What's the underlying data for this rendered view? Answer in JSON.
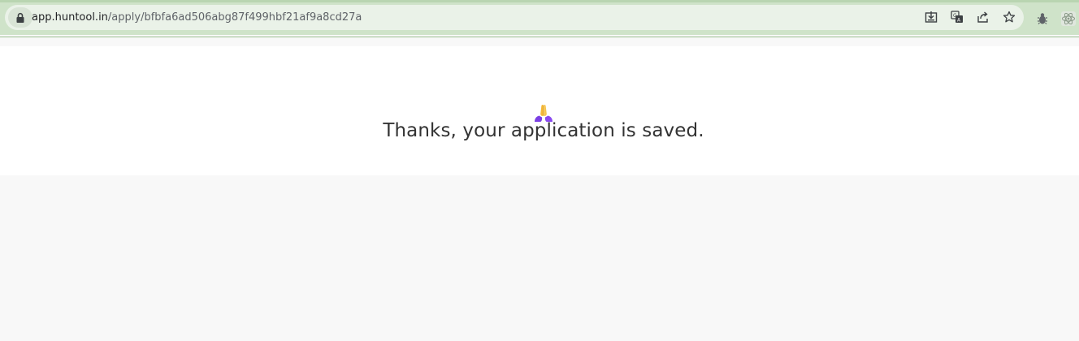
{
  "browser": {
    "url_domain": "app.huntool.in",
    "url_path": "/apply/bfbfa6ad506abg87f499hbf21af9a8cd27a",
    "toolbar_icons": [
      "install-icon",
      "translate-icon",
      "share-icon",
      "bookmark-star-icon"
    ],
    "extension_icons": [
      "bug-extension-icon",
      "react-devtools-icon"
    ]
  },
  "page": {
    "emoji": "folded-hands-emoji",
    "message": "Thanks, your application is saved."
  }
}
